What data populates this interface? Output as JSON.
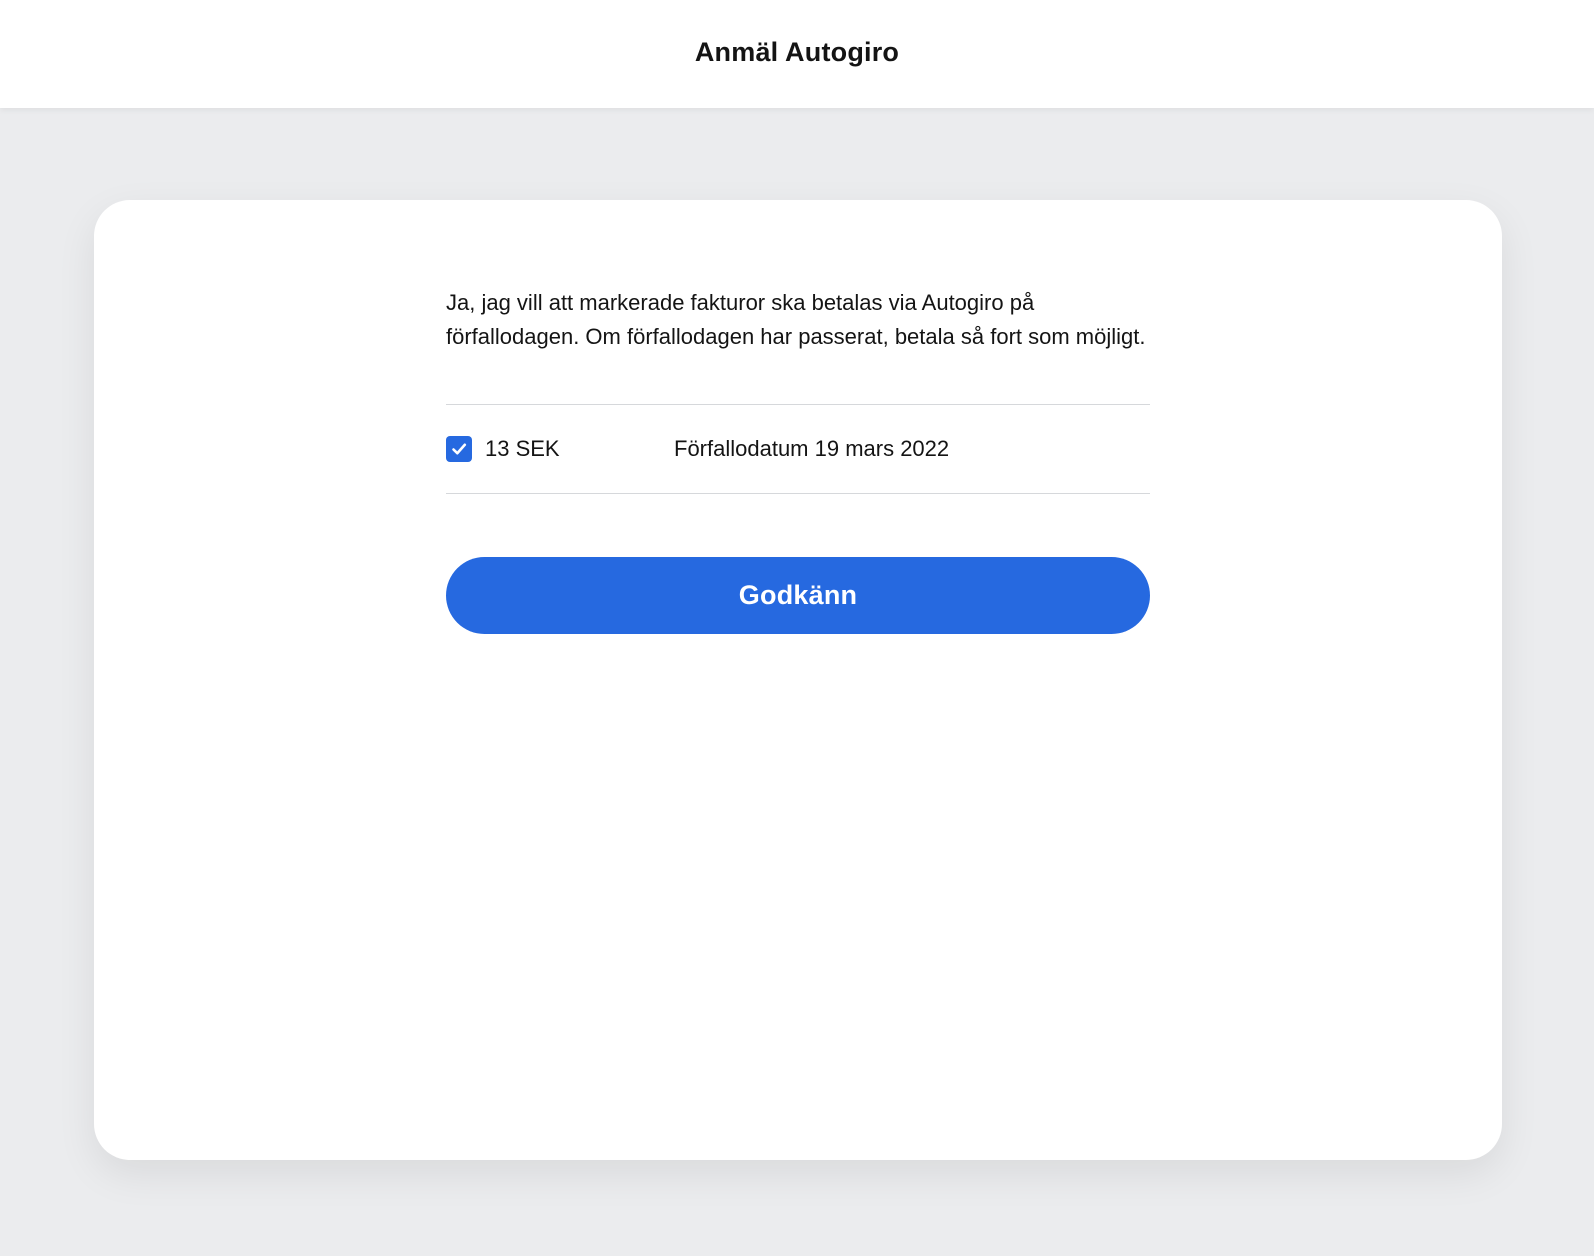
{
  "header": {
    "title": "Anmäl Autogiro"
  },
  "consent": {
    "text": "Ja, jag vill att markerade fakturor ska betalas via Autogiro på förfallodagen. Om förfallodagen har passerat, betala så fort som möjligt."
  },
  "invoices": [
    {
      "checked": true,
      "amount": "13 SEK",
      "due_date": "Förfallodatum 19 mars 2022"
    }
  ],
  "actions": {
    "approve_label": "Godkänn"
  },
  "colors": {
    "accent": "#2669e0",
    "background": "#ebecee",
    "card": "#ffffff"
  },
  "icons": {
    "checkbox": "checkmark-icon"
  }
}
